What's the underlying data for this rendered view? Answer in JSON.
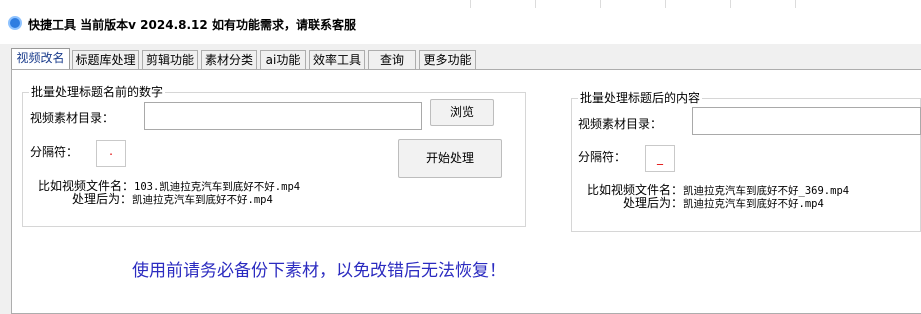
{
  "window": {
    "title": "快捷工具 当前版本v 2024.8.12",
    "hint": "如有功能需求，请联系客服",
    "icon": "app-logo-icon"
  },
  "tabs": [
    "视频改名",
    "标题库处理",
    "剪辑功能",
    "素材分类",
    "ai功能",
    "效率工具",
    "查询",
    "更多功能"
  ],
  "left_group": {
    "title": "批量处理标题名前的数字",
    "dir_label": "视频素材目录：",
    "dir_value": "",
    "browse_label": "浏览",
    "sep_label": "分隔符：",
    "sep_value": ".",
    "start_label": "开始处理",
    "example_label1": "比如视频文件名：",
    "example_value1": "103.凯迪拉克汽车到底好不好.mp4",
    "example_label2": "处理后为：",
    "example_value2": "凯迪拉克汽车到底好不好.mp4"
  },
  "right_group": {
    "title": "批量处理标题后的内容",
    "dir_label": "视频素材目录：",
    "dir_value": "",
    "sep_label": "分隔符：",
    "sep_value": "_",
    "example_label1": "比如视频文件名：",
    "example_value1": "凯迪拉克汽车到底好不好_369.mp4",
    "example_label2": "处理后为：",
    "example_value2": "凯迪拉克汽车到底好不好.mp4"
  },
  "warning": "使用前请务必备份下素材，以免改错后无法恢复！",
  "colors": {
    "active_tab_text": "#1a3c8c",
    "separator_text": "#e00000",
    "warning_text": "#2b2bc0"
  }
}
